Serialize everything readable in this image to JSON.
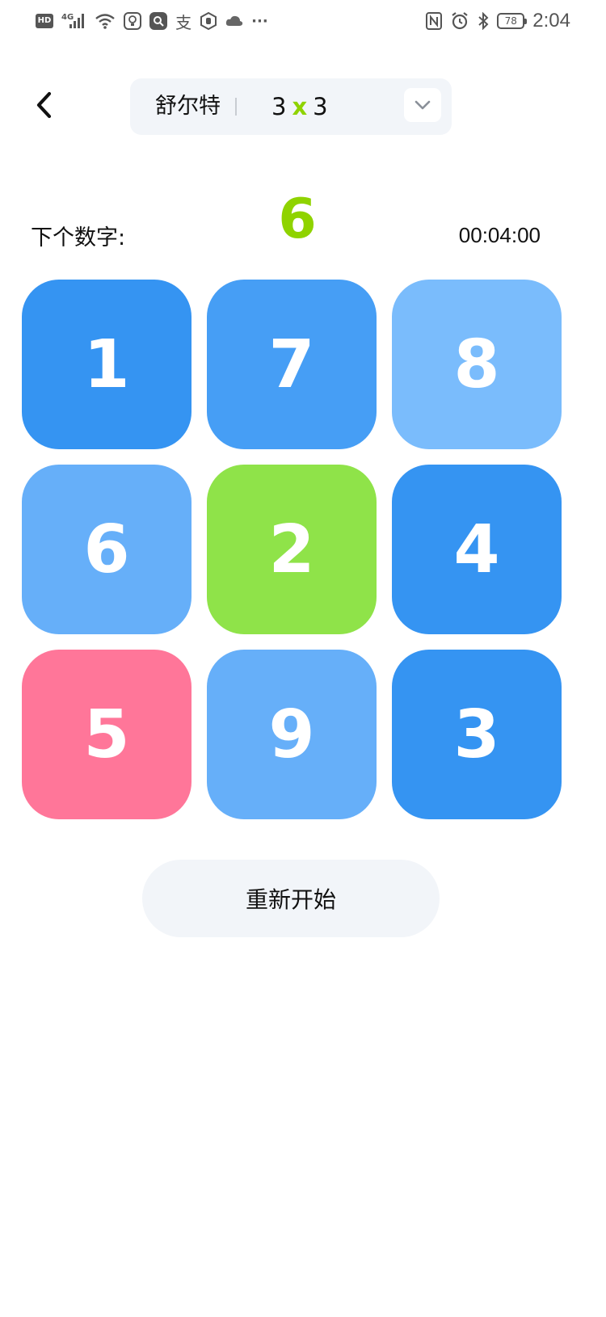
{
  "status_bar": {
    "hd": "HD",
    "network": "4G",
    "battery": "78",
    "time": "2:04",
    "alipay_glyph": "支",
    "more": "···",
    "icons": [
      "hd-icon",
      "signal-icon",
      "wifi-icon",
      "bulb-app-icon",
      "search-app-icon",
      "alipay-icon",
      "hand-app-icon",
      "cloud-icon",
      "more-icon",
      "nfc-icon",
      "alarm-icon",
      "bluetooth-icon",
      "battery-icon"
    ]
  },
  "header": {
    "back_icon": "chevron-left-icon",
    "mode_name": "舒尔特",
    "size_rows": "3",
    "size_sep": "x",
    "size_cols": "3",
    "dropdown_icon": "chevron-down-icon"
  },
  "info": {
    "next_label": "下个数字:",
    "next_number": "6",
    "timer": "00:04:00"
  },
  "grid": {
    "tiles": [
      {
        "number": "1",
        "color": "#3594f2"
      },
      {
        "number": "7",
        "color": "#469ef5"
      },
      {
        "number": "8",
        "color": "#7abcfc"
      },
      {
        "number": "6",
        "color": "#66aff9"
      },
      {
        "number": "2",
        "color": "#8fe349"
      },
      {
        "number": "4",
        "color": "#3594f2"
      },
      {
        "number": "5",
        "color": "#ff7699"
      },
      {
        "number": "9",
        "color": "#66aff9"
      },
      {
        "number": "3",
        "color": "#3594f2"
      }
    ]
  },
  "actions": {
    "restart_label": "重新开始"
  },
  "colors": {
    "accent_green": "#8fd300",
    "panel_bg": "#f2f5f9"
  }
}
